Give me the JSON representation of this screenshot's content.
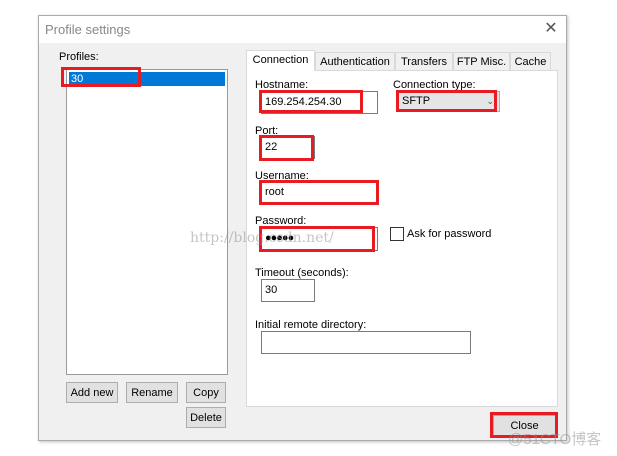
{
  "window": {
    "title": "Profile settings",
    "close_icon": "close-icon"
  },
  "profiles": {
    "label": "Profiles:",
    "items": [
      "30"
    ],
    "selected": "30"
  },
  "buttons": {
    "add_new": "Add new",
    "rename": "Rename",
    "copy": "Copy",
    "delete": "Delete",
    "close": "Close"
  },
  "tabs": [
    "Connection",
    "Authentication",
    "Transfers",
    "FTP Misc.",
    "Cache"
  ],
  "connection": {
    "hostname_label": "Hostname:",
    "hostname": "169.254.254.30",
    "connection_type_label": "Connection type:",
    "connection_type": "SFTP",
    "port_label": "Port:",
    "port": "22",
    "username_label": "Username:",
    "username": "root",
    "password_label": "Password:",
    "password": "●●●●●",
    "ask_password_label": "Ask for password",
    "ask_password": false,
    "timeout_label": "Timeout (seconds):",
    "timeout": "30",
    "remote_dir_label": "Initial remote directory:",
    "remote_dir": ""
  },
  "watermarks": {
    "csdn": "http://blog.csdn.net/",
    "cto": "@51CTO博客"
  },
  "colors": {
    "highlight": "#e81b23",
    "selection": "#0078d7"
  }
}
